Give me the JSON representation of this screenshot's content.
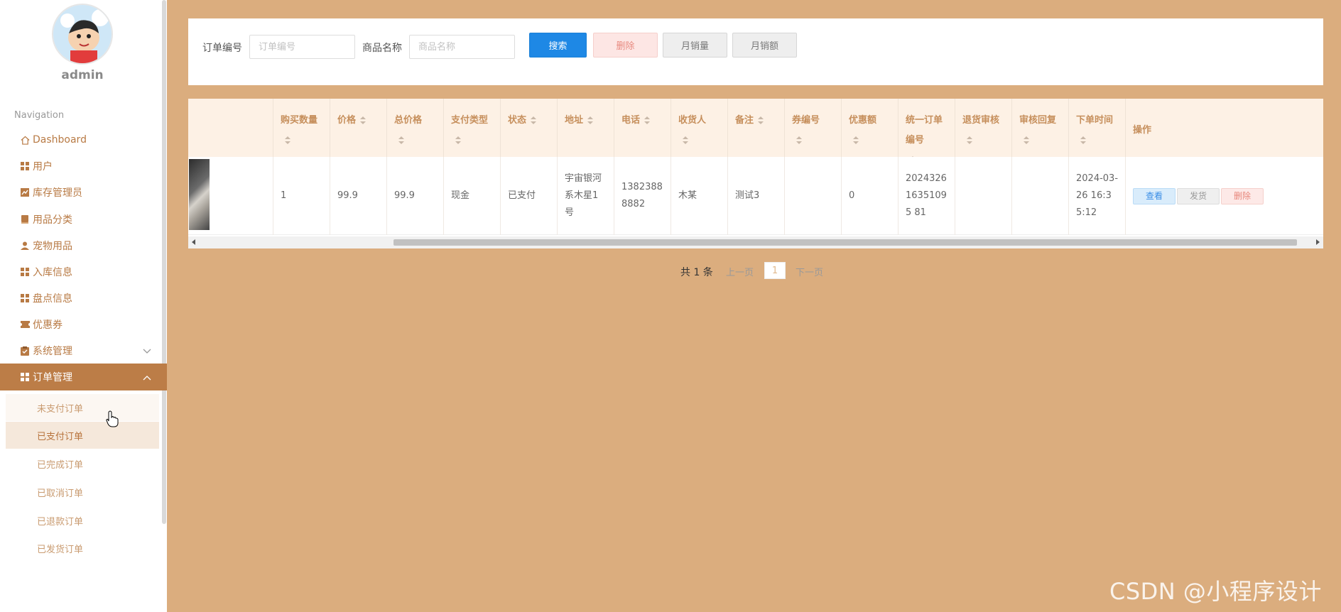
{
  "sidebar": {
    "username": "admin",
    "nav_title": "Navigation",
    "items": [
      {
        "label": "Dashboard",
        "icon": "home-icon"
      },
      {
        "label": "用户",
        "icon": "grid-icon"
      },
      {
        "label": "库存管理员",
        "icon": "chart-icon"
      },
      {
        "label": "用品分类",
        "icon": "book-icon"
      },
      {
        "label": "宠物用品",
        "icon": "user-icon"
      },
      {
        "label": "入库信息",
        "icon": "grid-icon"
      },
      {
        "label": "盘点信息",
        "icon": "grid-icon"
      },
      {
        "label": "优惠券",
        "icon": "ticket-icon"
      },
      {
        "label": "系统管理",
        "icon": "clipboard-icon"
      },
      {
        "label": "订单管理",
        "icon": "grid-icon"
      }
    ],
    "order_sub_items": [
      "未支付订单",
      "已支付订单",
      "已完成订单",
      "已取消订单",
      "已退款订单",
      "已发货订单"
    ]
  },
  "search": {
    "order_no_label": "订单编号",
    "order_no_placeholder": "订单编号",
    "product_label": "商品名称",
    "product_placeholder": "商品名称",
    "search_btn": "搜索",
    "delete_btn": "删除",
    "month_qty_btn": "月销量",
    "month_amount_btn": "月销额"
  },
  "table": {
    "headers": [
      "购买数量",
      "价格",
      "总价格",
      "支付类型",
      "状态",
      "地址",
      "电话",
      "收货人",
      "备注",
      "券编号",
      "优惠额",
      "统一订单编号",
      "退货审核",
      "审核回复",
      "下单时间",
      "操作"
    ],
    "row": {
      "quantity": "1",
      "price": "99.9",
      "total": "99.9",
      "pay_type": "现金",
      "status": "已支付",
      "address": "宇宙银河系木星1号",
      "phone": "13823888882",
      "receiver": "木某",
      "remark": "测试3",
      "coupon_no": "",
      "discount": "0",
      "order_no": "202432616351095 81",
      "return_review": "",
      "review_reply": "",
      "order_time": "2024-03-26 16:35:12"
    },
    "actions": {
      "view": "查看",
      "ship": "发货",
      "delete": "删除"
    }
  },
  "pagination": {
    "total": "共 1 条",
    "prev": "上一页",
    "current": "1",
    "next": "下一页"
  },
  "watermark": "CSDN @小程序设计",
  "colors": {
    "background": "#dbad7e",
    "accent": "#bc7d47",
    "search_button": "#1e88e5"
  }
}
